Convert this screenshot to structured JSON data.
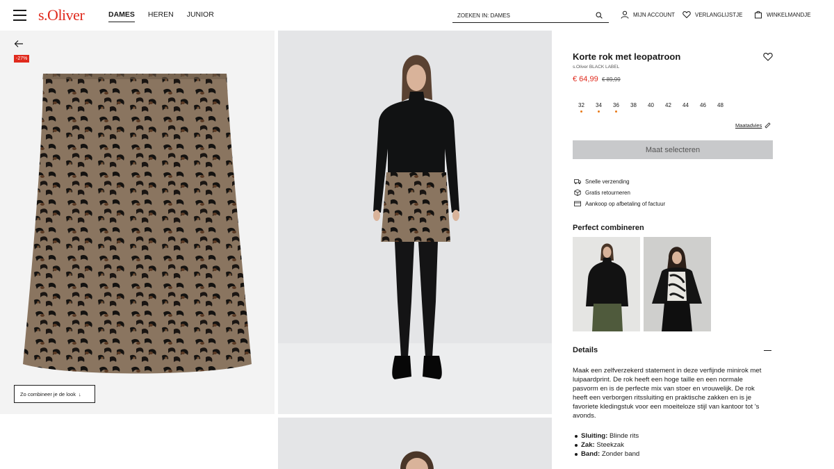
{
  "header": {
    "logo": "s.Oliver",
    "nav": [
      "DAMES",
      "HEREN",
      "JUNIOR"
    ],
    "search_placeholder": "ZOEKEN IN: DAMES",
    "account": "MIJN ACCOUNT",
    "wishlist": "VERLANGLIJSTJE",
    "cart": "WINKELMANDJE"
  },
  "gallery": {
    "discount_badge": "-27%",
    "combine_button": "Zo combineer je de look"
  },
  "product": {
    "title": "Korte rok met leopatroon",
    "brand": "s.Oliver BLACK LABEL",
    "price": "€ 64,99",
    "old_price": "€ 89,99",
    "sizes": [
      {
        "label": "32",
        "low_stock": true
      },
      {
        "label": "34",
        "low_stock": true
      },
      {
        "label": "36",
        "low_stock": true
      },
      {
        "label": "38",
        "low_stock": false
      },
      {
        "label": "40",
        "low_stock": false
      },
      {
        "label": "42",
        "low_stock": false
      },
      {
        "label": "44",
        "low_stock": false
      },
      {
        "label": "46",
        "low_stock": false
      },
      {
        "label": "48",
        "low_stock": false
      }
    ],
    "size_advice": "Maatadvies",
    "select_button": "Maat selecteren",
    "usps": [
      "Snelle verzending",
      "Gratis retourneren",
      "Aankoop op afbetaling of factuur"
    ],
    "combine_title": "Perfect combineren",
    "details_title": "Details",
    "description": "Maak een zelfverzekerd statement in deze verfijnde minirok met luipaardprint. De rok heeft een hoge taille en een normale pasvorm en is de perfecte mix van stoer en vrouwelijk. De rok heeft een verborgen ritssluiting en praktische zakken en is je favoriete kledingstuk voor een moeiteloze stijl van kantoor tot 's avonds.",
    "facts": [
      {
        "key": "Sluiting:",
        "value": "Blinde rits"
      },
      {
        "key": "Zak:",
        "value": "Steekzak"
      },
      {
        "key": "Band:",
        "value": "Zonder band"
      }
    ]
  },
  "colors": {
    "brand_red": "#e02a1d",
    "stock_dot": "#e87a1a",
    "button_disabled": "#c8c9cb"
  }
}
